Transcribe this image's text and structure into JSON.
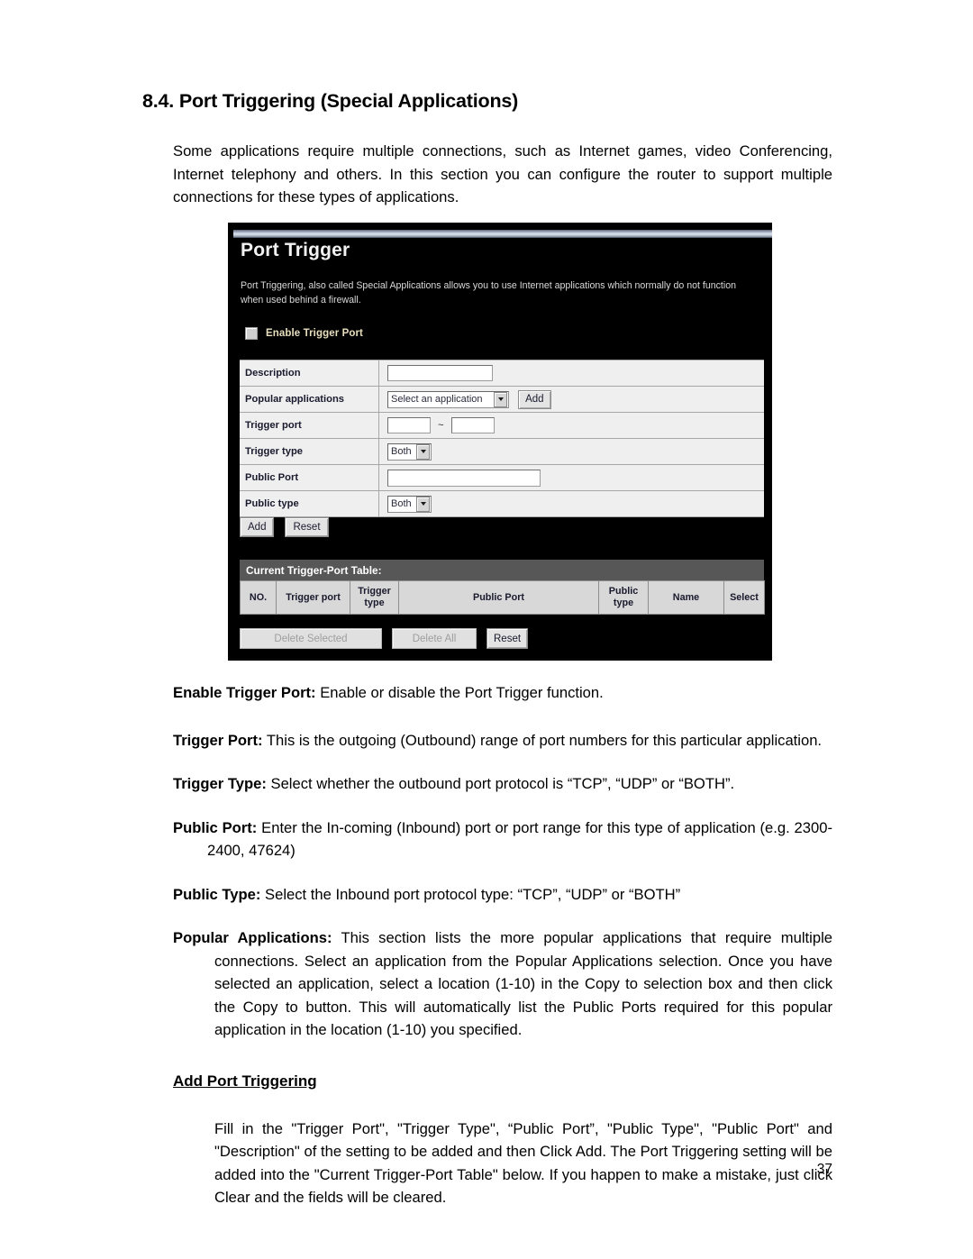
{
  "document": {
    "section_number_title": "8.4. Port Triggering (Special Applications)",
    "intro_paragraph": "Some applications require multiple connections, such as Internet games, video Conferencing, Internet telephony and others. In this section you can configure the router to support multiple connections for these types of applications.",
    "definitions": [
      {
        "term": "Enable Trigger Port:",
        "text": " Enable or disable the Port Trigger function."
      },
      {
        "term": "Trigger Port:",
        "text": " This is the outgoing (Outbound) range of port numbers for this particular application."
      },
      {
        "term": "Trigger Type:",
        "text": " Select whether the outbound port protocol is “TCP”, “UDP” or “BOTH”."
      },
      {
        "term": "Public Port:",
        "text": " Enter the In-coming (Inbound) port or port range for this type of application (e.g. 2300-2400, 47624)"
      },
      {
        "term": "Public Type:",
        "text": " Select the Inbound port protocol type: “TCP”, “UDP” or “BOTH”"
      },
      {
        "term": "Popular Applications:",
        "text": " This section lists the more popular applications that require multiple connections. Select an application from the Popular Applications selection. Once you have selected an application, select a location (1-10) in the Copy to selection box and then click the Copy to button. This will automatically list the Public Ports required for this popular application in the location (1-10) you specified."
      }
    ],
    "sub_heading": "Add Port Triggering",
    "add_paragraph": "Fill in the \"Trigger Port\", \"Trigger Type\", “Public Port”, \"Public Type\", \"Public Port\" and \"Description\" of the setting to be added and then Click Add. The Port Triggering setting will be added into the \"Current Trigger-Port Table\" below. If you happen to make a mistake, just click Clear and the fields will be cleared.",
    "page_number": "37"
  },
  "screenshot": {
    "title": "Port Trigger",
    "description": "Port Triggering, also called Special Applications allows you to use Internet applications which normally do not function when used behind a firewall.",
    "enable_checkbox_label": "Enable Trigger Port",
    "enable_checkbox_checked": false,
    "form_rows": [
      {
        "label": "Description",
        "control": "text",
        "value": ""
      },
      {
        "label": "Popular applications",
        "control": "select-add",
        "value": "Select an application",
        "button": "Add"
      },
      {
        "label": "Trigger port",
        "control": "range",
        "value_from": "",
        "value_to": "",
        "separator": "~"
      },
      {
        "label": "Trigger type",
        "control": "select",
        "value": "Both"
      },
      {
        "label": "Public Port",
        "control": "text-wide",
        "value": ""
      },
      {
        "label": "Public type",
        "control": "select",
        "value": "Both"
      }
    ],
    "form_buttons": [
      {
        "label": "Add",
        "disabled": false
      },
      {
        "label": "Reset",
        "disabled": false
      }
    ],
    "table_caption": "Current Trigger-Port Table:",
    "table_columns": [
      "NO.",
      "Trigger port",
      "Trigger type",
      "Public Port",
      "Public type",
      "Name",
      "Select"
    ],
    "table_rows": [],
    "table_buttons": [
      {
        "label": "Delete Selected",
        "disabled": true
      },
      {
        "label": "Delete All",
        "disabled": true
      },
      {
        "label": "Reset",
        "disabled": false
      }
    ]
  },
  "colors": {
    "page_background": "#ffffff",
    "text": "#000000",
    "screenshot_background": "#000000",
    "screenshot_title": "#f2f2f2",
    "enable_label": "#e8dfbe",
    "table_caption_bar": "#575757",
    "form_row_background": "#efefef",
    "table_header_background": "#d8d8d8"
  }
}
